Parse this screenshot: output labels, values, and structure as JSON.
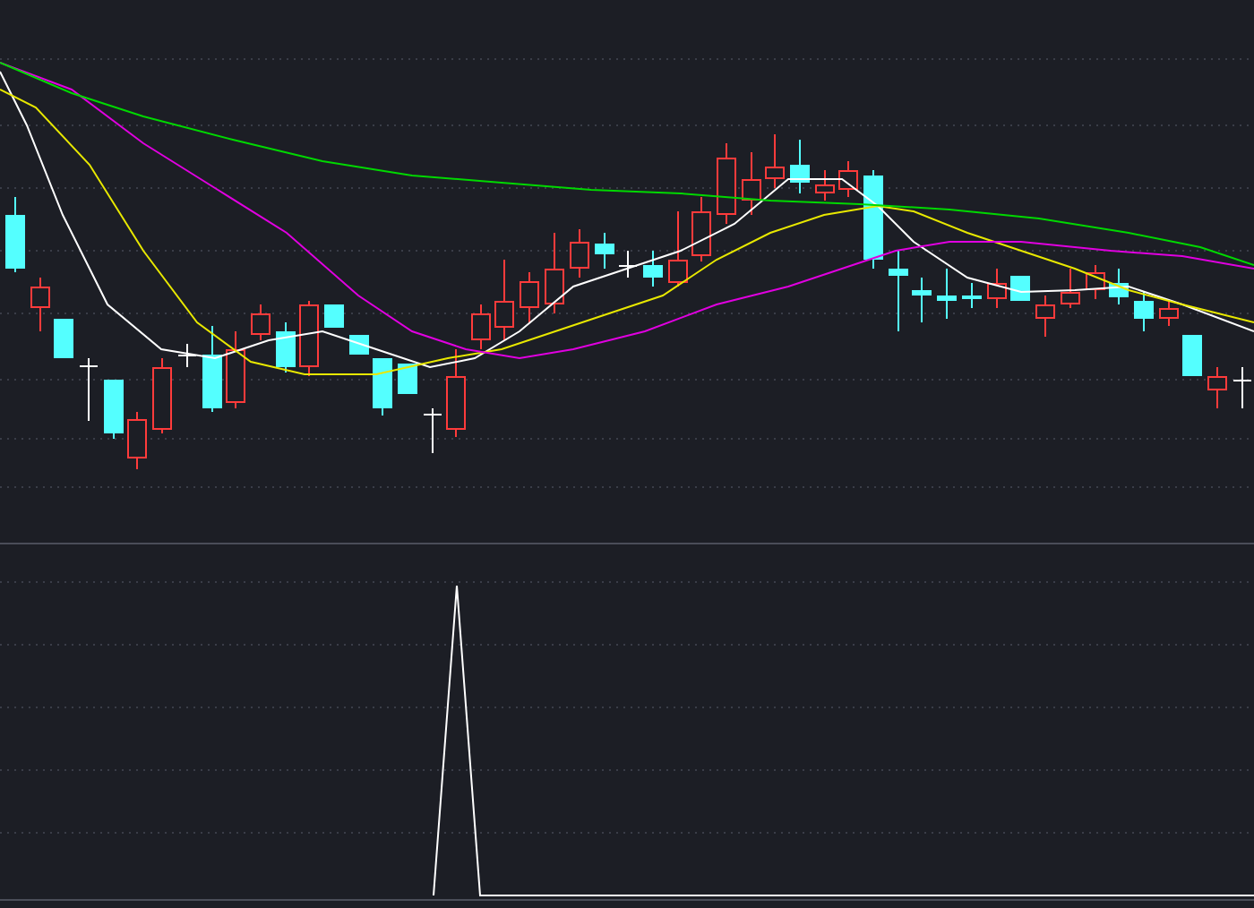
{
  "panels": [
    {
      "kind": "candlestick"
    },
    {
      "kind": "indicator"
    }
  ]
}
